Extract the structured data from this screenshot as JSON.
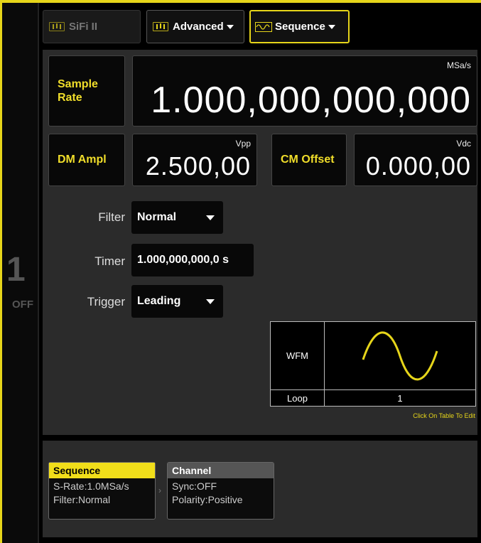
{
  "tabs": [
    {
      "label": "SiFi II",
      "active": false
    },
    {
      "label": "Advanced",
      "has_menu": true
    },
    {
      "label": "Sequence",
      "has_menu": true,
      "selected": true
    }
  ],
  "channel": {
    "number": "1",
    "state": "OFF"
  },
  "sample_rate": {
    "label": "Sample Rate",
    "value": "1.000,000,000,000",
    "unit": "MSa/s"
  },
  "dm_ampl": {
    "label": "DM Ampl",
    "value": "2.500,00",
    "unit": "Vpp"
  },
  "cm_offset": {
    "label": "CM Offset",
    "value": "0.000,00",
    "unit": "Vdc"
  },
  "filter": {
    "label": "Filter",
    "value": "Normal"
  },
  "timer": {
    "label": "Timer",
    "value": "1.000,000,000,0 s"
  },
  "trigger": {
    "label": "Trigger",
    "value": "Leading"
  },
  "sequence_table": {
    "wfm_label": "WFM",
    "loop_label": "Loop",
    "loop_value": "1",
    "hint": "Click On Table To Edit"
  },
  "cards": {
    "sequence": {
      "title": "Sequence",
      "line1": "S-Rate:1.0MSa/s",
      "line2": "Filter:Normal"
    },
    "channel": {
      "title": "Channel",
      "line1": "Sync:OFF",
      "line2": "Polarity:Positive"
    }
  },
  "colors": {
    "accent": "#e6d51a",
    "panel": "#2b2b2b",
    "background": "#000000"
  }
}
